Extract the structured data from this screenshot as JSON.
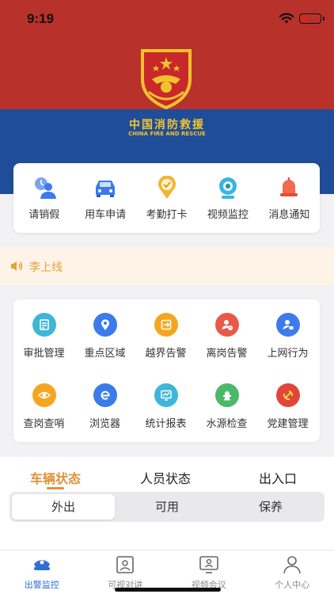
{
  "status_bar": {
    "time": "9:19"
  },
  "header": {
    "org_name": "中国消防救援",
    "org_name_en": "CHINA FIRE AND RESCUE"
  },
  "quick_actions": [
    {
      "label": "请销假",
      "icon": "leave-request-icon"
    },
    {
      "label": "用车申请",
      "icon": "car-icon"
    },
    {
      "label": "考勤打卡",
      "icon": "check-in-icon"
    },
    {
      "label": "视频监控",
      "icon": "camera-icon"
    },
    {
      "label": "消息通知",
      "icon": "bell-icon"
    }
  ],
  "notice": {
    "text": "李上线"
  },
  "grid": [
    {
      "label": "审批管理",
      "icon": "approval-icon",
      "color": "#3fb6d8"
    },
    {
      "label": "重点区域",
      "icon": "location-icon",
      "color": "#3d7bea"
    },
    {
      "label": "越界告警",
      "icon": "boundary-icon",
      "color": "#f4a623"
    },
    {
      "label": "离岗告警",
      "icon": "person-alert-icon",
      "color": "#e8594a"
    },
    {
      "label": "上网行为",
      "icon": "internet-user-icon",
      "color": "#3d7bea"
    },
    {
      "label": "查岗查哨",
      "icon": "eye-icon",
      "color": "#f4a623"
    },
    {
      "label": "浏览器",
      "icon": "browser-icon",
      "color": "#3d7bea"
    },
    {
      "label": "统计报表",
      "icon": "chart-icon",
      "color": "#3fb6d8"
    },
    {
      "label": "水源检查",
      "icon": "hydrant-icon",
      "color": "#4cb86b"
    },
    {
      "label": "党建管理",
      "icon": "party-icon",
      "color": "#e0463a"
    }
  ],
  "status_tabs": {
    "tabs": [
      "车辆状态",
      "人员状态",
      "出入口"
    ],
    "active": "车辆状态",
    "segments": [
      "外出",
      "可用",
      "保养"
    ],
    "active_segment": "外出"
  },
  "bottom_nav": [
    {
      "label": "出警监控",
      "icon": "police-cap-icon",
      "active": true
    },
    {
      "label": "可视对讲",
      "icon": "video-intercom-icon",
      "active": false
    },
    {
      "label": "视频会议",
      "icon": "video-conference-icon",
      "active": false
    },
    {
      "label": "个人中心",
      "icon": "profile-icon",
      "active": false
    }
  ],
  "colors": {
    "accent": "#e0923a",
    "header_red": "#b8322b",
    "header_blue": "#1f4d99",
    "nav_active": "#2f6fd6"
  }
}
